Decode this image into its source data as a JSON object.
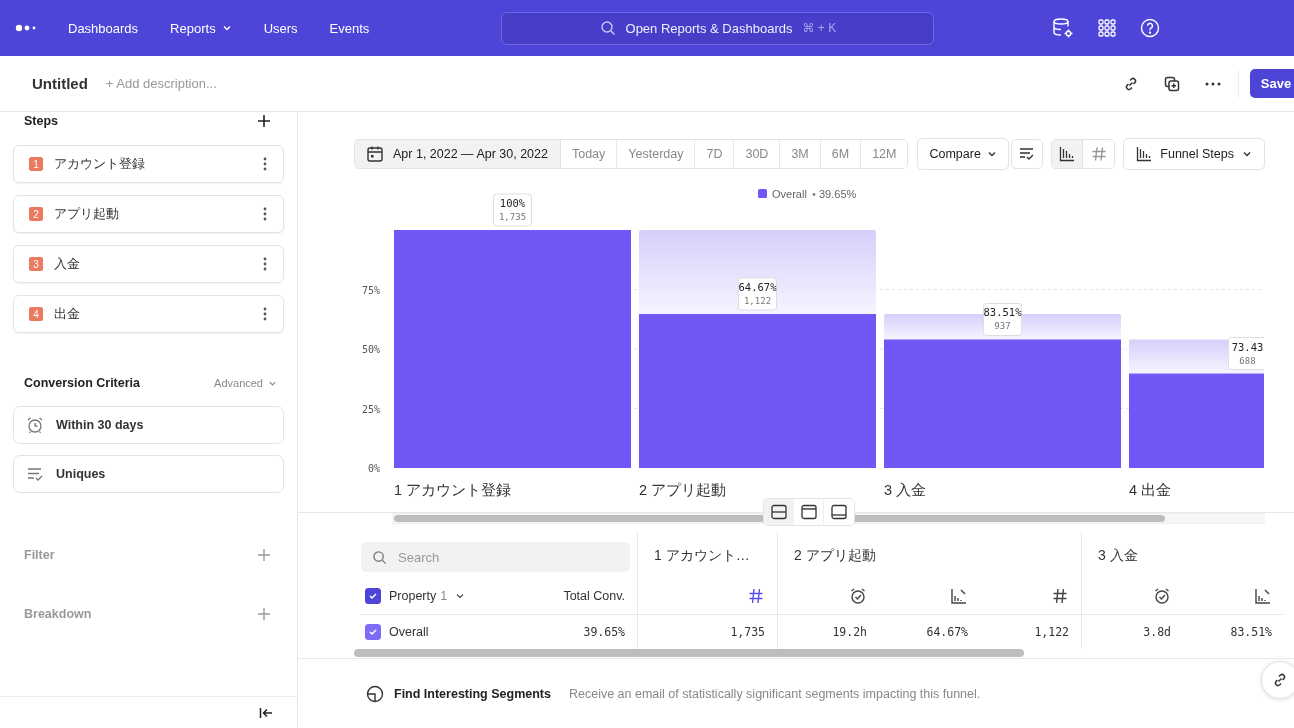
{
  "nav": {
    "items": [
      {
        "label": "Dashboards"
      },
      {
        "label": "Reports",
        "dropdown": true
      },
      {
        "label": "Users"
      },
      {
        "label": "Events"
      }
    ],
    "search": {
      "placeholder": "Open Reports & Dashboards",
      "shortcut": "⌘ + K"
    }
  },
  "header": {
    "title": "Untitled",
    "description_placeholder": "+ Add description...",
    "save": "Save"
  },
  "sidebar": {
    "steps_title": "Steps",
    "steps": [
      {
        "number": "1",
        "name": "アカウント登録"
      },
      {
        "number": "2",
        "name": "アプリ起動"
      },
      {
        "number": "3",
        "name": "入金"
      },
      {
        "number": "4",
        "name": "出金"
      }
    ],
    "criteria_title": "Conversion Criteria",
    "criteria_mode": "Advanced",
    "criteria": [
      {
        "kind": "window",
        "label": "Within 30 days"
      },
      {
        "kind": "counting",
        "label": "Uniques"
      }
    ],
    "sections": [
      "Filter",
      "Breakdown"
    ]
  },
  "toolbar": {
    "date_range": "Apr 1, 2022 — Apr 30, 2022",
    "presets": [
      {
        "label": "Today",
        "selected": false
      },
      {
        "label": "Yesterday",
        "selected": false
      },
      {
        "label": "7D",
        "selected": false
      },
      {
        "label": "30D",
        "selected": false
      },
      {
        "label": "3M",
        "selected": false
      },
      {
        "label": "6M",
        "selected": false
      },
      {
        "label": "12M",
        "selected": false
      }
    ],
    "compare": "Compare",
    "views": [
      {
        "kind": "bars",
        "selected": true
      },
      {
        "kind": "number",
        "selected": false
      }
    ],
    "chart_type": "Funnel Steps"
  },
  "chart": {
    "legend_value": "39.65%",
    "chart_data": {
      "type": "bar",
      "categories": [
        "1 アカウント登録",
        "2 アプリ起動",
        "3 入金",
        "4 出金"
      ],
      "series": [
        {
          "name": "Overall",
          "color": "#7357f6",
          "values": [
            100,
            64.7,
            54,
            39.7
          ]
        }
      ],
      "grid": true,
      "ylim": [
        0,
        100
      ],
      "yticks": [
        {
          "value": 0,
          "label": "0%"
        },
        {
          "value": 25,
          "label": "25%"
        },
        {
          "value": 50,
          "label": "50%"
        },
        {
          "value": 75,
          "label": "75%"
        }
      ],
      "value_labels": [
        {
          "percent": "100%",
          "count": "1,735"
        },
        {
          "percent": "64.67%",
          "count": "1,122"
        },
        {
          "percent": "83.51%",
          "count": "937"
        },
        {
          "percent": "73.43",
          "count": "688"
        }
      ]
    }
  },
  "layouts": [
    {
      "kind": "split",
      "selected": true
    },
    {
      "kind": "top",
      "selected": false
    },
    {
      "kind": "bottom",
      "selected": false
    }
  ],
  "table": {
    "search_placeholder": "Search",
    "header_checked": true,
    "property": "Property",
    "property_count": "1",
    "total_header": "Total Conv.",
    "row": {
      "checked": true,
      "label": "Overall",
      "total": "39.65%"
    },
    "steps": [
      {
        "title": "1 アカウント…",
        "metrics": [
          {
            "kind": "count",
            "selected": true,
            "value": "1,735"
          }
        ]
      },
      {
        "title": "2 アプリ起動",
        "metrics": [
          {
            "kind": "time",
            "selected": false,
            "value": "19.2h"
          },
          {
            "kind": "rate",
            "selected": false,
            "value": "64.67%"
          },
          {
            "kind": "count",
            "selected": false,
            "value": "1,122"
          }
        ]
      },
      {
        "title": "3 入金",
        "metrics": [
          {
            "kind": "time",
            "selected": false,
            "value": "3.8d"
          },
          {
            "kind": "rate",
            "selected": false,
            "value": "83.51%"
          }
        ]
      }
    ]
  },
  "footer": {
    "title": "Find Interesting Segments",
    "text": "Receive an email of statistically significant segments impacting this funnel."
  }
}
